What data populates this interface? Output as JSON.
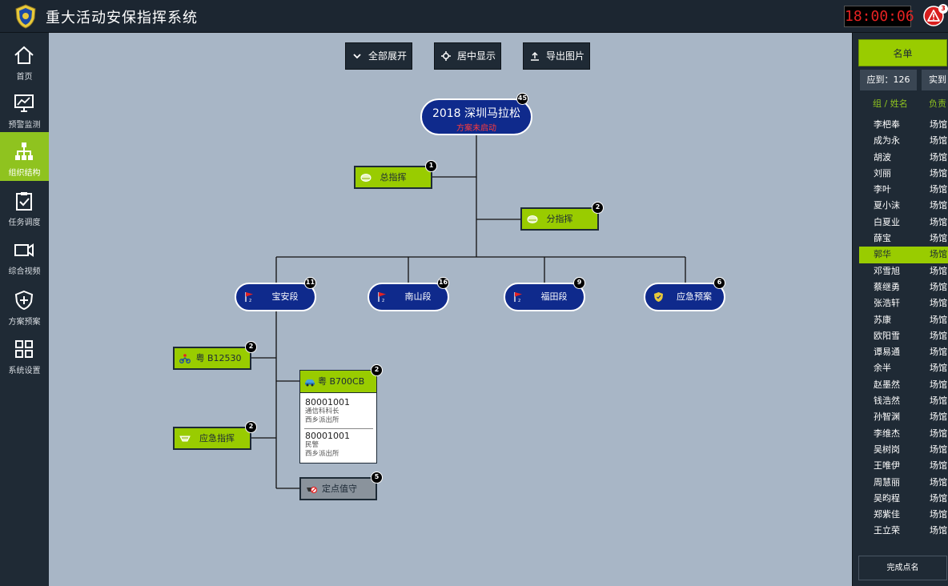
{
  "header": {
    "title": "重大活动安保指挥系统",
    "clock": "18:00:06",
    "alert_count": "3"
  },
  "sidebar": {
    "items": [
      {
        "label": "首页",
        "icon": "home-icon"
      },
      {
        "label": "预警监测",
        "icon": "monitor-icon"
      },
      {
        "label": "组织结构",
        "icon": "org-chart-icon",
        "active": true
      },
      {
        "label": "任务调度",
        "icon": "clipboard-check-icon"
      },
      {
        "label": "综合视频",
        "icon": "video-icon"
      },
      {
        "label": "方案预案",
        "icon": "shield-plus-icon"
      },
      {
        "label": "系统设置",
        "icon": "grid-icon"
      }
    ]
  },
  "toolbar": {
    "expand": "全部展开",
    "center": "居中显示",
    "export": "导出图片"
  },
  "tree": {
    "root": {
      "title": "2018 深圳马拉松",
      "status": "方案未启动",
      "count": "45"
    },
    "commanders": [
      {
        "label": "总指挥",
        "count": "1"
      },
      {
        "label": "分指挥",
        "count": "2"
      }
    ],
    "sections": [
      {
        "label": "宝安段",
        "count": "11"
      },
      {
        "label": "南山段",
        "count": "16"
      },
      {
        "label": "福田段",
        "count": "9"
      },
      {
        "label": "应急预案",
        "count": "6"
      }
    ],
    "units": [
      {
        "label": "粤 B12530",
        "count": "2"
      },
      {
        "label": "应急指挥",
        "count": "2"
      },
      {
        "label": "定点值守",
        "count": "5"
      }
    ],
    "vehicle": {
      "label": "粤 B700CB",
      "count": "2",
      "members": [
        {
          "id": "80001001",
          "role": "通信科科长",
          "unit": "西乡派出所"
        },
        {
          "id": "80001001",
          "role": "民警",
          "unit": "西乡派出所"
        }
      ]
    }
  },
  "roster": {
    "button": "名单",
    "expected": "应到：126",
    "actual": "实到",
    "col_name": "组 / 姓名",
    "col_role": "负责",
    "rows": [
      {
        "name": "李杷奉",
        "role": "场馆"
      },
      {
        "name": "成为永",
        "role": "场馆"
      },
      {
        "name": "胡波",
        "role": "场馆"
      },
      {
        "name": "刘丽",
        "role": "场馆"
      },
      {
        "name": "李叶",
        "role": "场馆"
      },
      {
        "name": "夏小沫",
        "role": "场馆"
      },
      {
        "name": "白夏业",
        "role": "场馆"
      },
      {
        "name": "薛宝",
        "role": "场馆"
      },
      {
        "name": "郭华",
        "role": "场馆",
        "selected": true
      },
      {
        "name": "邓雪旭",
        "role": "场馆"
      },
      {
        "name": "蔡继勇",
        "role": "场馆"
      },
      {
        "name": "张浩轩",
        "role": "场馆"
      },
      {
        "name": "苏康",
        "role": "场馆"
      },
      {
        "name": "欧阳雪",
        "role": "场馆"
      },
      {
        "name": "谭易通",
        "role": "场馆"
      },
      {
        "name": "余半",
        "role": "场馆"
      },
      {
        "name": "赵墨然",
        "role": "场馆"
      },
      {
        "name": "钱浩然",
        "role": "场馆"
      },
      {
        "name": "孙智渊",
        "role": "场馆"
      },
      {
        "name": "李维杰",
        "role": "场馆"
      },
      {
        "name": "吴树岗",
        "role": "场馆"
      },
      {
        "name": "王唯伊",
        "role": "场馆"
      },
      {
        "name": "周慧丽",
        "role": "场馆"
      },
      {
        "name": "吴昀程",
        "role": "场馆"
      },
      {
        "name": "郑紫佳",
        "role": "场馆"
      },
      {
        "name": "王立荣",
        "role": "场馆"
      }
    ],
    "done_button": "完成点名"
  },
  "colors": {
    "accent_green": "#99cc00",
    "node_blue": "#0f2a8c",
    "canvas_bg": "#a8b6c6",
    "alert_red": "#e52222"
  }
}
